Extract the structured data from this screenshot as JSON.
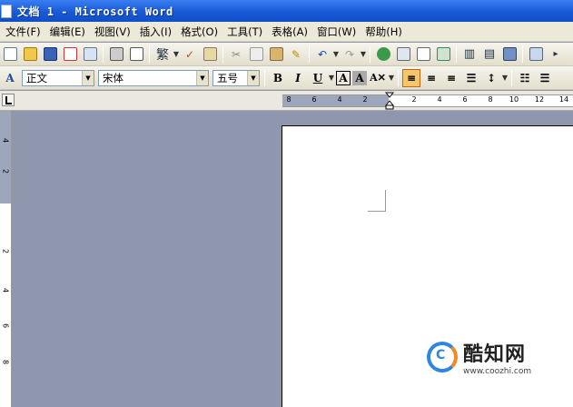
{
  "window": {
    "title": "文档 1 - Microsoft Word"
  },
  "menubar": [
    "文件(F)",
    "编辑(E)",
    "视图(V)",
    "插入(I)",
    "格式(O)",
    "工具(T)",
    "表格(A)",
    "窗口(W)",
    "帮助(H)"
  ],
  "formatting": {
    "style": "正文",
    "font": "宋体",
    "size": "五号",
    "bold": "B",
    "italic": "I",
    "underline": "U"
  },
  "ruler": {
    "left_numbers": [
      "8",
      "6",
      "4",
      "2"
    ],
    "right_numbers": [
      "2",
      "4",
      "6",
      "8",
      "10",
      "12",
      "14"
    ]
  },
  "vruler": {
    "numbers": [
      "4",
      "2",
      "2",
      "4",
      "6",
      "8"
    ]
  },
  "watermark": {
    "name": "酷知网",
    "url": "www.coozhi.com"
  },
  "colors": {
    "titlebar": "#1859d6",
    "workspace": "#8e97ad",
    "toolbar": "#ece9d8",
    "active": "#f6c768"
  }
}
